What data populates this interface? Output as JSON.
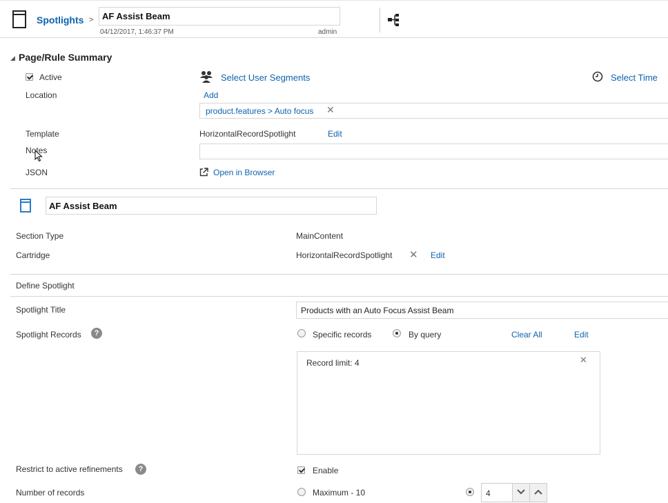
{
  "header": {
    "breadcrumb_root": "Spotlights",
    "breadcrumb_sep": ">",
    "page_name": "AF Assist Beam",
    "timestamp": "04/12/2017, 1:46:37 PM",
    "user": "admin"
  },
  "summary": {
    "heading": "Page/Rule Summary",
    "active_label": "Active",
    "active_checked": true,
    "segments_link": "Select User Segments",
    "time_link": "Select Time",
    "location_label": "Location",
    "location_add": "Add",
    "location_value": "product.features > Auto focus",
    "template_label": "Template",
    "template_value": "HorizontalRecordSpotlight",
    "template_edit": "Edit",
    "notes_label": "Notes",
    "notes_value": "",
    "json_label": "JSON",
    "json_link": "Open in Browser"
  },
  "section": {
    "name": "AF Assist Beam",
    "section_type_label": "Section Type",
    "section_type_value": "MainContent",
    "cartridge_label": "Cartridge",
    "cartridge_value": "HorizontalRecordSpotlight",
    "cartridge_edit": "Edit"
  },
  "spotlight": {
    "heading": "Define Spotlight",
    "title_label": "Spotlight Title",
    "title_value": "Products with an Auto Focus Assist Beam",
    "records_label": "Spotlight Records",
    "specific_label": "Specific records",
    "by_query_label": "By query",
    "selected_mode": "By query",
    "clear_all": "Clear All",
    "edit": "Edit",
    "record_limit_text": "Record limit: 4",
    "restrict_label": "Restrict to active refinements",
    "enable_label": "Enable",
    "enable_checked": true,
    "num_records_label": "Number of records",
    "maximum_label": "Maximum - 10",
    "num_records_value": "4"
  },
  "icons": {
    "page": "page-icon",
    "tree": "tree-icon",
    "users": "user-group-icon",
    "clock": "clock-icon",
    "external": "external-link-icon",
    "help": "help-icon",
    "close": "close-icon"
  },
  "colors": {
    "link": "#0d63ad",
    "section_icon": "#2b7bc4"
  }
}
